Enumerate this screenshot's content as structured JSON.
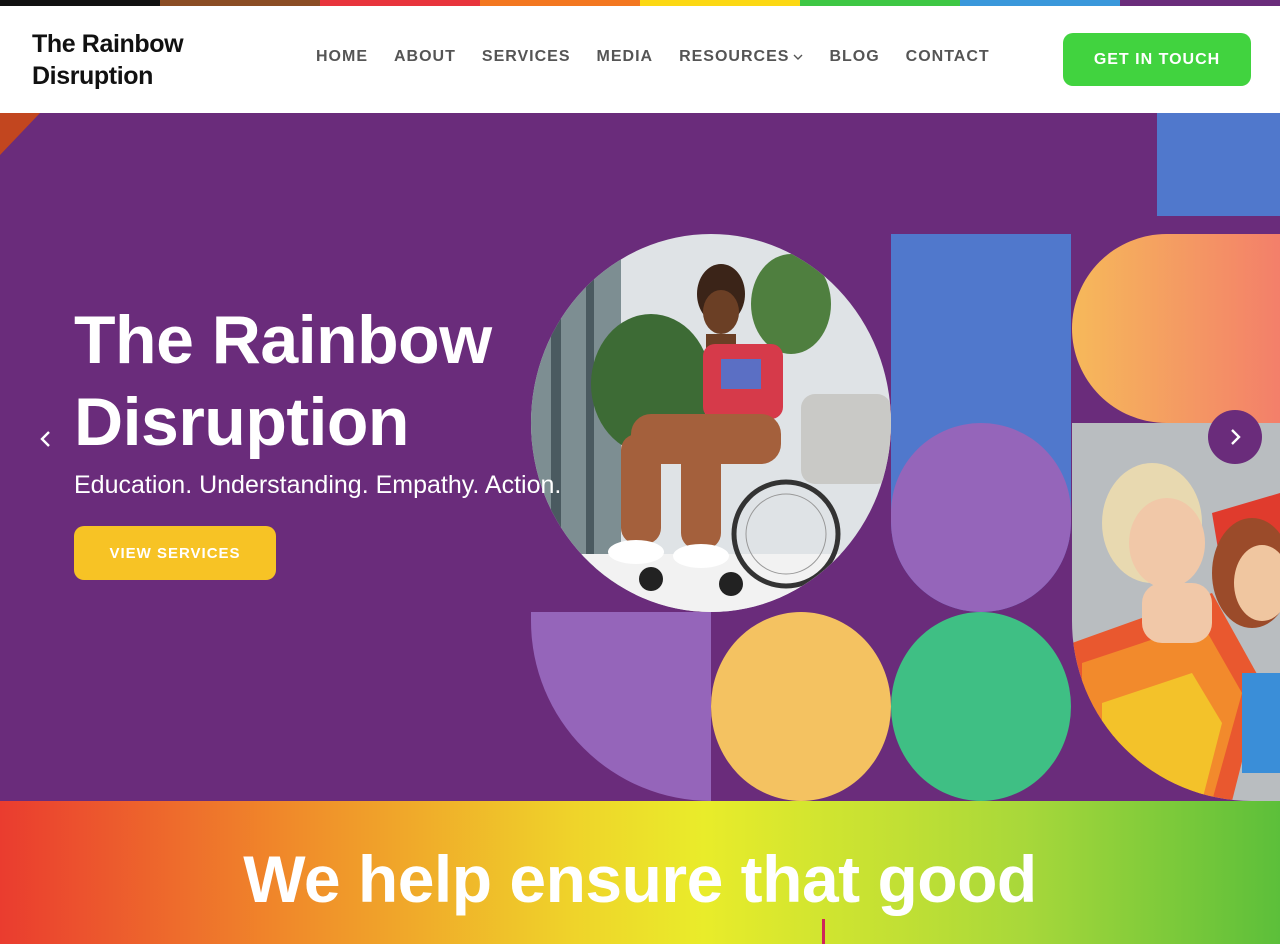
{
  "brand": {
    "name_line1": "The Rainbow",
    "name_line2": "Disruption"
  },
  "nav": {
    "items": [
      {
        "label": "HOME"
      },
      {
        "label": "ABOUT"
      },
      {
        "label": "SERVICES"
      },
      {
        "label": "MEDIA"
      },
      {
        "label": "RESOURCES",
        "has_dropdown": true
      },
      {
        "label": "BLOG"
      },
      {
        "label": "CONTACT"
      }
    ],
    "cta_label": "GET IN TOUCH"
  },
  "hero": {
    "title_line1": "The Rainbow",
    "title_line2": "Disruption",
    "tagline": "Education. Understanding. Empathy. Action.",
    "button_label": "VIEW SERVICES"
  },
  "band": {
    "heading": "We help ensure that good"
  },
  "colors": {
    "stripe": [
      "#111111",
      "#8b4d24",
      "#e8343c",
      "#f37720",
      "#fcd813",
      "#3ec744",
      "#3a98db",
      "#6a2c7b"
    ],
    "cta_green": "#41d33f",
    "hero_purple": "#6a2c7b",
    "button_yellow": "#f7c325",
    "shape_blue": "#5078cc",
    "shape_lilac": "#9565ba",
    "shape_peach": "#f4c261",
    "shape_green": "#3fbf84",
    "shape_orange": "#f5a35c"
  },
  "icons": {
    "prev": "chevron-left-icon",
    "next": "chevron-right-icon",
    "dropdown": "chevron-down-icon"
  }
}
